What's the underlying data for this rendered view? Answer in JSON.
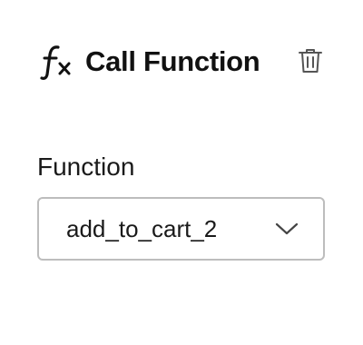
{
  "header": {
    "icon": "function-fx-icon",
    "title": "Call Function",
    "delete_icon": "trash-icon"
  },
  "form": {
    "function_label": "Function",
    "function_select": {
      "selected_value": "add_to_cart_2",
      "icon": "chevron-down-icon"
    }
  },
  "colors": {
    "text": "#111111",
    "border": "#bdbdbd",
    "icon_gray": "#555555"
  }
}
